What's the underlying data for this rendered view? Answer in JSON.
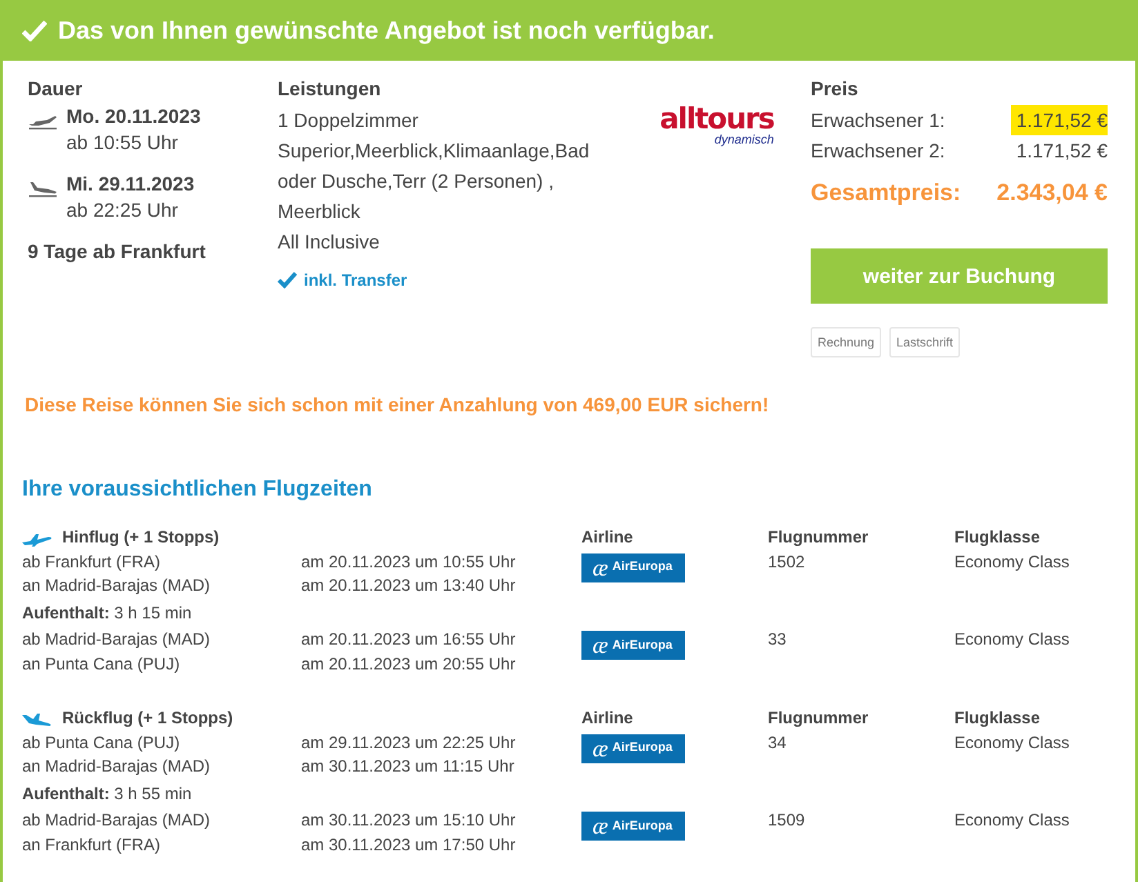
{
  "banner": {
    "text": "Das von Ihnen gewünschte Angebot ist noch verfügbar."
  },
  "duration": {
    "heading": "Dauer",
    "dates": [
      {
        "kind": "departure",
        "date": "Mo. 20.11.2023",
        "time": "ab 10:55 Uhr"
      },
      {
        "kind": "arrival",
        "date": "Mi. 29.11.2023",
        "time": "ab 22:25 Uhr"
      }
    ],
    "summary": "9 Tage ab Frankfurt"
  },
  "services": {
    "heading": "Leistungen",
    "lines": [
      "1 Doppelzimmer",
      "Superior,Meerblick,Klimaanlage,Bad oder Dusche,Terr (2 Personen) ,",
      "Meerblick",
      "All Inclusive"
    ],
    "transfer": "inkl. Transfer"
  },
  "operator_logo": {
    "name": "alltours",
    "subtitle": "dynamisch"
  },
  "price": {
    "heading": "Preis",
    "rows": [
      {
        "label": "Erwachsener 1:",
        "amount": "1.171,52 €",
        "highlighted": true
      },
      {
        "label": "Erwachsener 2:",
        "amount": "1.171,52 €",
        "highlighted": false
      }
    ],
    "total_label": "Gesamtpreis:",
    "total_amount": "2.343,04 €"
  },
  "book_button": "weiter zur Buchung",
  "payment_methods": [
    "Rechnung",
    "Lastschrift"
  ],
  "deposit_note": "Diese Reise können Sie sich schon mit einer Anzahlung von 469,00 EUR sichern!",
  "flights": {
    "heading": "Ihre voraussichtlichen Flugzeiten",
    "legs": [
      {
        "kind": "outbound",
        "title": "Hinflug (+ 1 Stopps)",
        "columns": [
          "Airline",
          "Flugnummer",
          "Flugklasse"
        ],
        "items": [
          {
            "kind": "segment",
            "from": "ab Frankfurt (FRA)",
            "departure": "am 20.11.2023 um 10:55 Uhr",
            "to": "an Madrid-Barajas (MAD)",
            "arrival": "am 20.11.2023 um 13:40 Uhr",
            "airline_mark": "æ",
            "airline_name": "AirEuropa",
            "number": "1502",
            "class": "Economy Class"
          },
          {
            "kind": "stopover",
            "label": "Aufenthalt:",
            "value": "3 h 15 min"
          },
          {
            "kind": "segment",
            "from": "ab Madrid-Barajas (MAD)",
            "departure": "am 20.11.2023 um 16:55 Uhr",
            "to": "an Punta Cana (PUJ)",
            "arrival": "am 20.11.2023 um 20:55 Uhr",
            "airline_mark": "æ",
            "airline_name": "AirEuropa",
            "number": "33",
            "class": "Economy Class"
          }
        ]
      },
      {
        "kind": "return",
        "title": "Rückflug (+ 1 Stopps)",
        "columns": [
          "Airline",
          "Flugnummer",
          "Flugklasse"
        ],
        "items": [
          {
            "kind": "segment",
            "from": "ab Punta Cana (PUJ)",
            "departure": "am 29.11.2023 um 22:25 Uhr",
            "to": "an Madrid-Barajas (MAD)",
            "arrival": "am 30.11.2023 um 11:15 Uhr",
            "airline_mark": "æ",
            "airline_name": "AirEuropa",
            "number": "34",
            "class": "Economy Class"
          },
          {
            "kind": "stopover",
            "label": "Aufenthalt:",
            "value": "3 h 55 min"
          },
          {
            "kind": "segment",
            "from": "ab Madrid-Barajas (MAD)",
            "departure": "am 30.11.2023 um 15:10 Uhr",
            "to": "an Frankfurt (FRA)",
            "arrival": "am 30.11.2023 um 17:50 Uhr",
            "airline_mark": "æ",
            "airline_name": "AirEuropa",
            "number": "1509",
            "class": "Economy Class"
          }
        ]
      }
    ]
  }
}
